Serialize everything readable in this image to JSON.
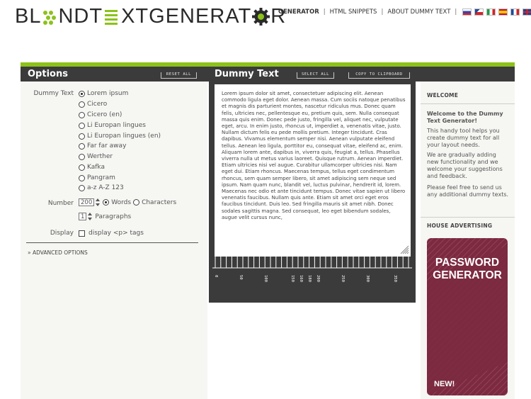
{
  "header": {
    "logo_part1": "BL",
    "logo_part2": "NDT",
    "logo_part3": "XTGENERAT",
    "logo_part4": "R",
    "nav": [
      "GENERATOR",
      "HTML SNIPPETS",
      "ABOUT DUMMY TEXT"
    ],
    "flags": [
      "russian-flag-icon",
      "czech-flag-icon",
      "italian-flag-icon",
      "spanish-flag-icon",
      "french-flag-icon",
      "english-flag-icon",
      "german-flag-icon"
    ]
  },
  "colors": {
    "accent": "#8cc21a",
    "panel_dark": "#3b3b3b",
    "panel_light": "#f6f6f3",
    "ad_bg": "#7b2a40"
  },
  "options": {
    "title": "Options",
    "reset_label": "RESET ALL",
    "dummy_text_label": "Dummy Text",
    "text_choices": [
      {
        "label": "Lorem ipsum",
        "selected": true
      },
      {
        "label": "Cicero",
        "selected": false
      },
      {
        "label": "Cicero (en)",
        "selected": false
      },
      {
        "label": "Li Europan lingues",
        "selected": false
      },
      {
        "label": "Li Europan lingues (en)",
        "selected": false
      },
      {
        "label": "Far far away",
        "selected": false
      },
      {
        "label": "Werther",
        "selected": false
      },
      {
        "label": "Kafka",
        "selected": false
      },
      {
        "label": "Pangram",
        "selected": false
      },
      {
        "label": "a-z A-Z 123",
        "selected": false
      }
    ],
    "number_label": "Number",
    "number_value": "200",
    "words_label": "Words",
    "characters_label": "Characters",
    "paragraphs_value": "1",
    "paragraphs_label": "Paragraphs",
    "display_label": "Display",
    "display_option": "display <p> tags",
    "advanced_label": "» ADVANCED OPTIONS"
  },
  "dummy": {
    "title": "Dummy Text",
    "select_all_label": "SELECT ALL",
    "copy_label": "COPY TO CLIPBOARD",
    "text": "Lorem ipsum dolor sit amet, consectetuer adipiscing elit. Aenean commodo ligula eget dolor. Aenean massa. Cum sociis natoque penatibus et magnis dis parturient montes, nascetur ridiculus mus. Donec quam felis, ultricies nec, pellentesque eu, pretium quis, sem. Nulla consequat massa quis enim. Donec pede justo, fringilla vel, aliquet nec, vulputate eget, arcu. In enim justo, rhoncus ut, imperdiet a, venenatis vitae, justo. Nullam dictum felis eu pede mollis pretium. Integer tincidunt. Cras dapibus. Vivamus elementum semper nisi. Aenean vulputate eleifend tellus. Aenean leo ligula, porttitor eu, consequat vitae, eleifend ac, enim. Aliquam lorem ante, dapibus in, viverra quis, feugiat a, tellus. Phasellus viverra nulla ut metus varius laoreet. Quisque rutrum. Aenean imperdiet. Etiam ultricies nisi vel augue. Curabitur ullamcorper ultricies nisi. Nam eget dui. Etiam rhoncus. Maecenas tempus, tellus eget condimentum rhoncus, sem quam semper libero, sit amet adipiscing sem neque sed ipsum. Nam quam nunc, blandit vel, luctus pulvinar, hendrerit id, lorem. Maecenas nec odio et ante tincidunt tempus. Donec vitae sapien ut libero venenatis faucibus. Nullam quis ante. Etiam sit amet orci eget eros faucibus tincidunt. Duis leo. Sed fringilla mauris sit amet nibh. Donec sodales sagittis magna. Sed consequat, leo eget bibendum sodales, augue velit cursus nunc,",
    "ruler_labels": [
      "0",
      "50",
      "100",
      "150",
      "160",
      "180",
      "200",
      "250",
      "300",
      "350"
    ]
  },
  "sidebar": {
    "welcome_head": "WELCOME",
    "welcome_title": "Welcome to the Dummy Text Generator!",
    "welcome_p1": "This handy tool helps you create dummy text for all your layout needs.",
    "welcome_p2": "We are gradually adding new functionality and we welcome your suggestions and feedback.",
    "welcome_p3": "Please feel free to send us any additional dummy texts.",
    "ad_head": "HOUSE ADVERTISING",
    "ad_title": "PASSWORD GENERATOR",
    "ad_new": "NEW!"
  }
}
